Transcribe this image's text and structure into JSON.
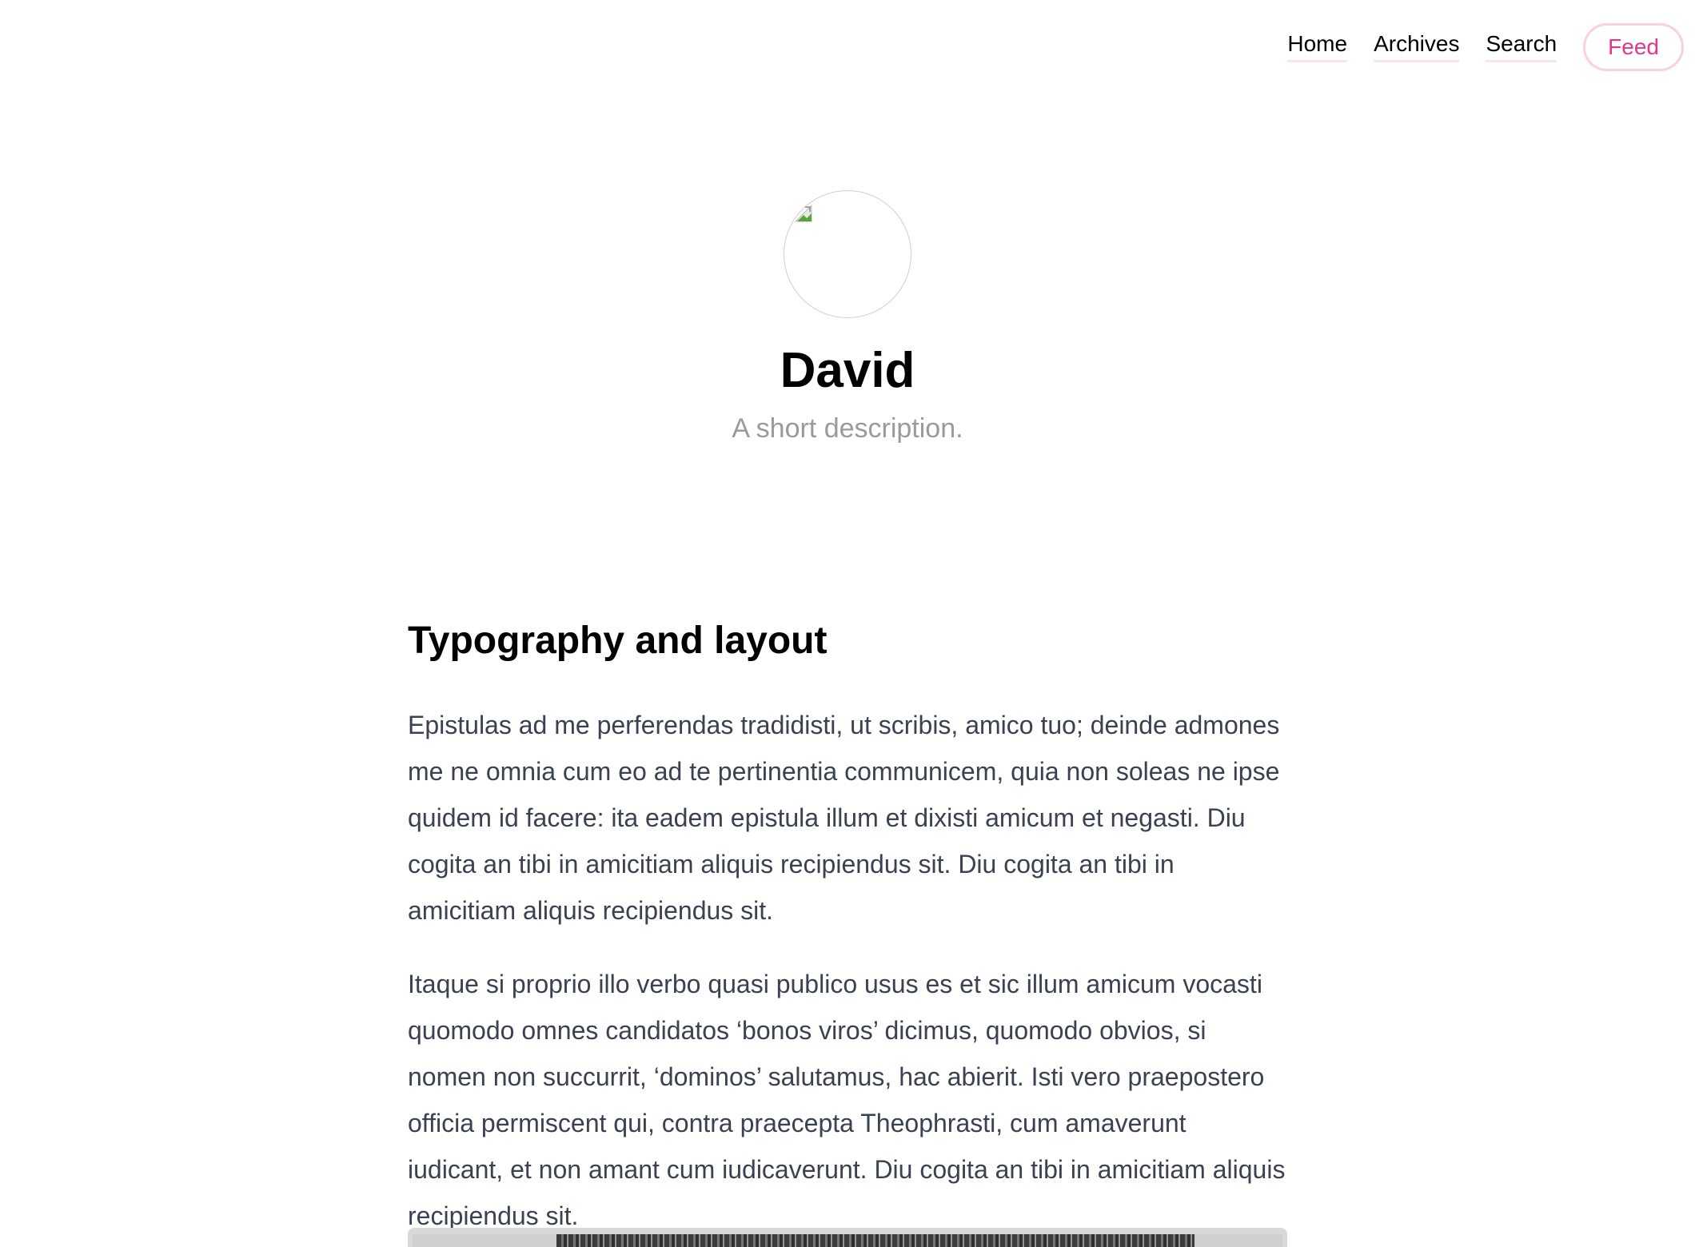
{
  "nav": {
    "home": "Home",
    "archives": "Archives",
    "search": "Search",
    "feed": "Feed"
  },
  "hero": {
    "title": "David",
    "description": "A short description."
  },
  "article": {
    "heading": "Typography and layout",
    "paragraphs": [
      "Epistulas ad me perferendas tradidisti, ut scribis, amico tuo; deinde admones me ne omnia cum eo ad te pertinentia communicem, quia non soleas ne ipse quidem id facere: ita eadem epistula illum et dixisti amicum et negasti. Diu cogita an tibi in amicitiam aliquis recipiendus sit. Diu cogita an tibi in amicitiam aliquis recipiendus sit.",
      "Itaque si proprio illo verbo quasi publico usus es et sic illum amicum vocasti quomodo omnes candidatos ‘bonos viros’ dicimus, quomodo obvios, si nomen non succurrit, ‘dominos’ salutamus, hac abierit. Isti vero praepostero officia permiscent qui, contra praecepta Theophrasti, cum amaverunt iudicant, et non amant cum iudicaverunt. Diu cogita an tibi in amicitiam aliquis recipiendus sit."
    ]
  },
  "colors": {
    "accent": "#e6368a",
    "accent_border": "#fbcfe2",
    "body_text": "#3a4150",
    "muted_text": "#9a9a9a"
  },
  "icons": {
    "avatar": "broken-image-icon"
  }
}
